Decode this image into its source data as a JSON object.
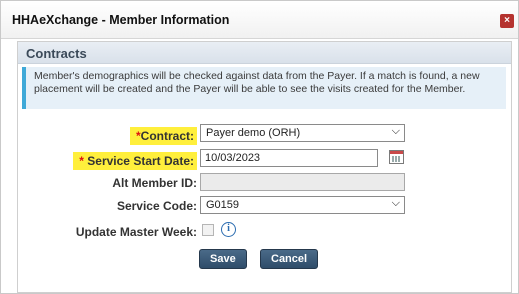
{
  "window": {
    "title": "HHAeXchange - Member Information",
    "close_label": "×"
  },
  "section": {
    "title": "Contracts"
  },
  "info_message": "Member's demographics will be checked against data from the Payer. If a match is found, a new placement will be created and the Payer will be able to see the visits created for the Member.",
  "form": {
    "contract": {
      "required_mark": "*",
      "label": "Contract:",
      "value": "Payer demo (ORH)"
    },
    "service_start_date": {
      "required_mark": "*",
      "label": "Service Start Date:",
      "value": "10/03/2023"
    },
    "alt_member_id": {
      "label": "Alt Member ID:",
      "value": ""
    },
    "service_code": {
      "label": "Service Code:",
      "value": "G0159"
    },
    "update_master_week": {
      "label": "Update Master Week:",
      "checked": false,
      "info_icon": "i"
    }
  },
  "buttons": {
    "save": "Save",
    "cancel": "Cancel"
  },
  "colors": {
    "highlight": "#ffef3c",
    "button": "#2f4d6a",
    "info_border": "#3fa9d8"
  }
}
